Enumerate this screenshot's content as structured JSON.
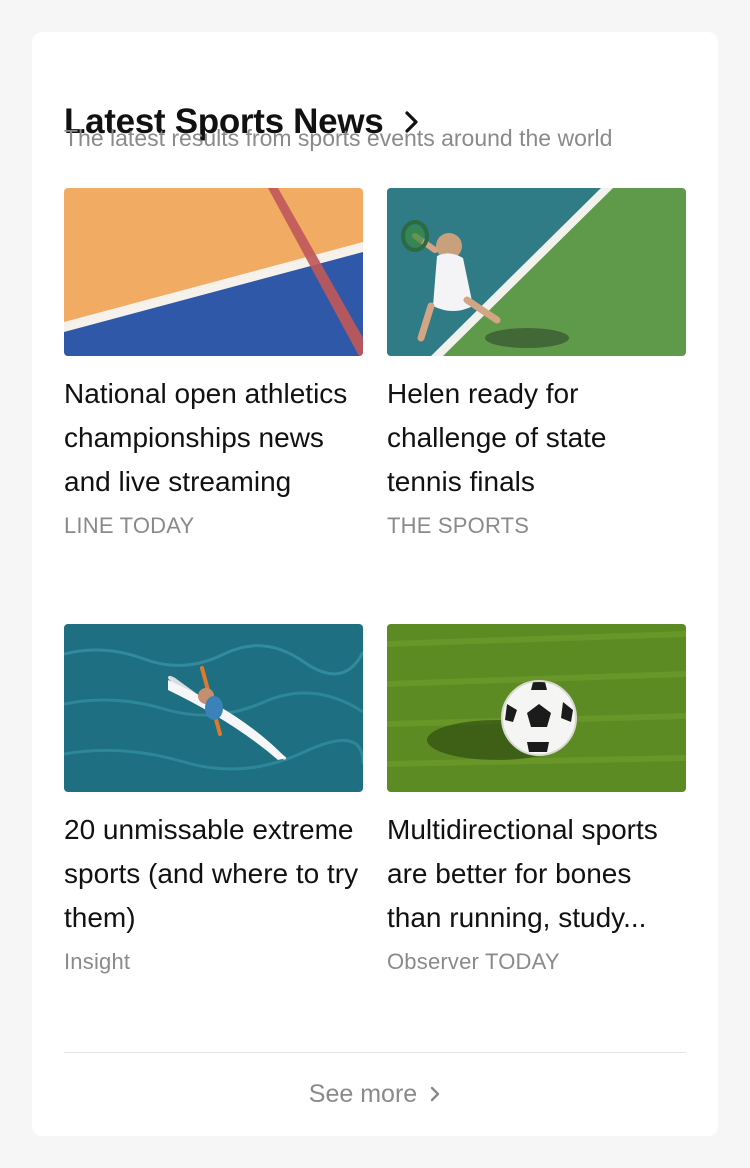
{
  "section": {
    "title": "Latest Sports News",
    "subtitle": "The latest results from sports events around the world",
    "title_icon": "chevron-right-icon"
  },
  "articles": [
    {
      "headline": "National open athletics championships news and live streaming",
      "source": "LINE TODAY",
      "image": "track-court-image"
    },
    {
      "headline": "Helen ready for challenge of state tennis finals",
      "source": "THE SPORTS",
      "image": "tennis-player-image"
    },
    {
      "headline": "20 unmissable extreme sports (and where to try them)",
      "source": "Insight",
      "image": "paddleboard-image"
    },
    {
      "headline": "Multidirectional sports are better for bones than running, study...",
      "source": "Observer TODAY",
      "image": "soccer-ball-image"
    }
  ],
  "footer": {
    "see_more_label": "See more",
    "see_more_icon": "chevron-right-icon"
  },
  "colors": {
    "text": "#111111",
    "muted": "#8a8a8a",
    "divider": "#e4e4e4",
    "card": "#ffffff",
    "background": "#f6f6f6"
  }
}
